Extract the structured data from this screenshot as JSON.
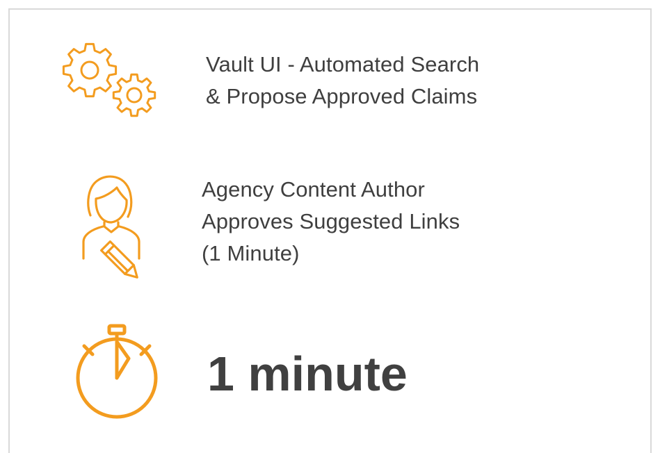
{
  "accent_color": "#F39C1F",
  "text_color": "#3F3F3F",
  "steps": [
    {
      "icon": "gears-icon",
      "lines": [
        "Vault UI - Automated Search",
        "& Propose Approved Claims"
      ]
    },
    {
      "icon": "author-with-pencil-icon",
      "lines": [
        "Agency Content Author",
        "Approves Suggested Links",
        "(1 Minute)"
      ]
    }
  ],
  "total": {
    "icon": "stopwatch-icon",
    "value": "1 minute"
  }
}
